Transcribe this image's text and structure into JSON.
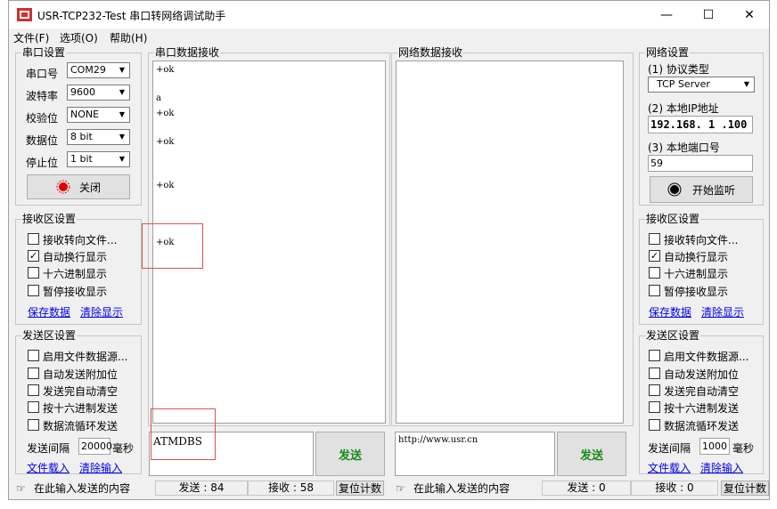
{
  "window": {
    "title": "USR-TCP232-Test 串口转网络调试助手",
    "minimize": "—",
    "maximize": "☐",
    "close": "✕"
  },
  "menu": [
    "文件(F)",
    "选项(O)",
    "帮助(H)"
  ],
  "serial_settings": {
    "title": "串口设置",
    "port_label": "串口号",
    "port_value": "COM29",
    "baud_label": "波特率",
    "baud_value": "9600",
    "parity_label": "校验位",
    "parity_value": "NONE",
    "databits_label": "数据位",
    "databits_value": "8 bit",
    "stopbits_label": "停止位",
    "stopbits_value": "1 bit",
    "close_button": "关闭"
  },
  "left_receive": {
    "title": "接收区设置",
    "options": [
      {
        "label": "接收转向文件...",
        "checked": false
      },
      {
        "label": "自动换行显示",
        "checked": true
      },
      {
        "label": "十六进制显示",
        "checked": false
      },
      {
        "label": "暂停接收显示",
        "checked": false
      }
    ],
    "save_link": "保存数据",
    "clear_link": "清除显示"
  },
  "left_send": {
    "title": "发送区设置",
    "options": [
      {
        "label": "启用文件数据源...",
        "checked": false
      },
      {
        "label": "自动发送附加位",
        "checked": false
      },
      {
        "label": "发送完自动清空",
        "checked": false
      },
      {
        "label": "按十六进制发送",
        "checked": false
      },
      {
        "label": "数据流循环发送",
        "checked": false
      }
    ],
    "interval_label": "发送间隔",
    "interval_value": "20000",
    "interval_unit": "毫秒",
    "load_link": "文件载入",
    "clear_link": "清除输入"
  },
  "serial_receive": {
    "title": "串口数据接收",
    "lines": [
      "+ok",
      "",
      "a",
      "+ok",
      "",
      "+ok",
      "",
      "",
      "+ok",
      "",
      "",
      "",
      "+ok"
    ]
  },
  "serial_send": {
    "text": "ATMDBS",
    "send_button": "发送"
  },
  "net_receive": {
    "title": "网络数据接收"
  },
  "net_send": {
    "text": "http://www.usr.cn",
    "send_button": "发送"
  },
  "net_settings": {
    "title": "网络设置",
    "protocol_label": "(1) 协议类型",
    "protocol_value": "TCP Server",
    "ip_label": "(2) 本地IP地址",
    "ip_value": "192.168. 1 .100",
    "port_label": "(3) 本地端口号",
    "port_value": "59",
    "listen_button": "开始监听"
  },
  "right_receive": {
    "title": "接收区设置",
    "options": [
      {
        "label": "接收转向文件...",
        "checked": false
      },
      {
        "label": "自动换行显示",
        "checked": true
      },
      {
        "label": "十六进制显示",
        "checked": false
      },
      {
        "label": "暂停接收显示",
        "checked": false
      }
    ],
    "save_link": "保存数据",
    "clear_link": "清除显示"
  },
  "right_send": {
    "title": "发送区设置",
    "options": [
      {
        "label": "启用文件数据源...",
        "checked": false
      },
      {
        "label": "自动发送附加位",
        "checked": false
      },
      {
        "label": "发送完自动清空",
        "checked": false
      },
      {
        "label": "按十六进制发送",
        "checked": false
      },
      {
        "label": "数据流循环发送",
        "checked": false
      }
    ],
    "interval_label": "发送间隔",
    "interval_value": "1000",
    "interval_unit": "毫秒",
    "load_link": "文件载入",
    "clear_link": "清除输入"
  },
  "status_left": {
    "hint": "在此输入发送的内容",
    "sent": "发送 : 84",
    "received": "接收 : 58",
    "reset": "复位计数"
  },
  "status_right": {
    "hint": "在此输入发送的内容",
    "sent": "发送 : 0",
    "received": "接收 : 0",
    "reset": "复位计数"
  },
  "colors": {
    "accent_red": "#e00000",
    "link_blue": "#0000ee",
    "send_green": "#1a8a1a"
  }
}
